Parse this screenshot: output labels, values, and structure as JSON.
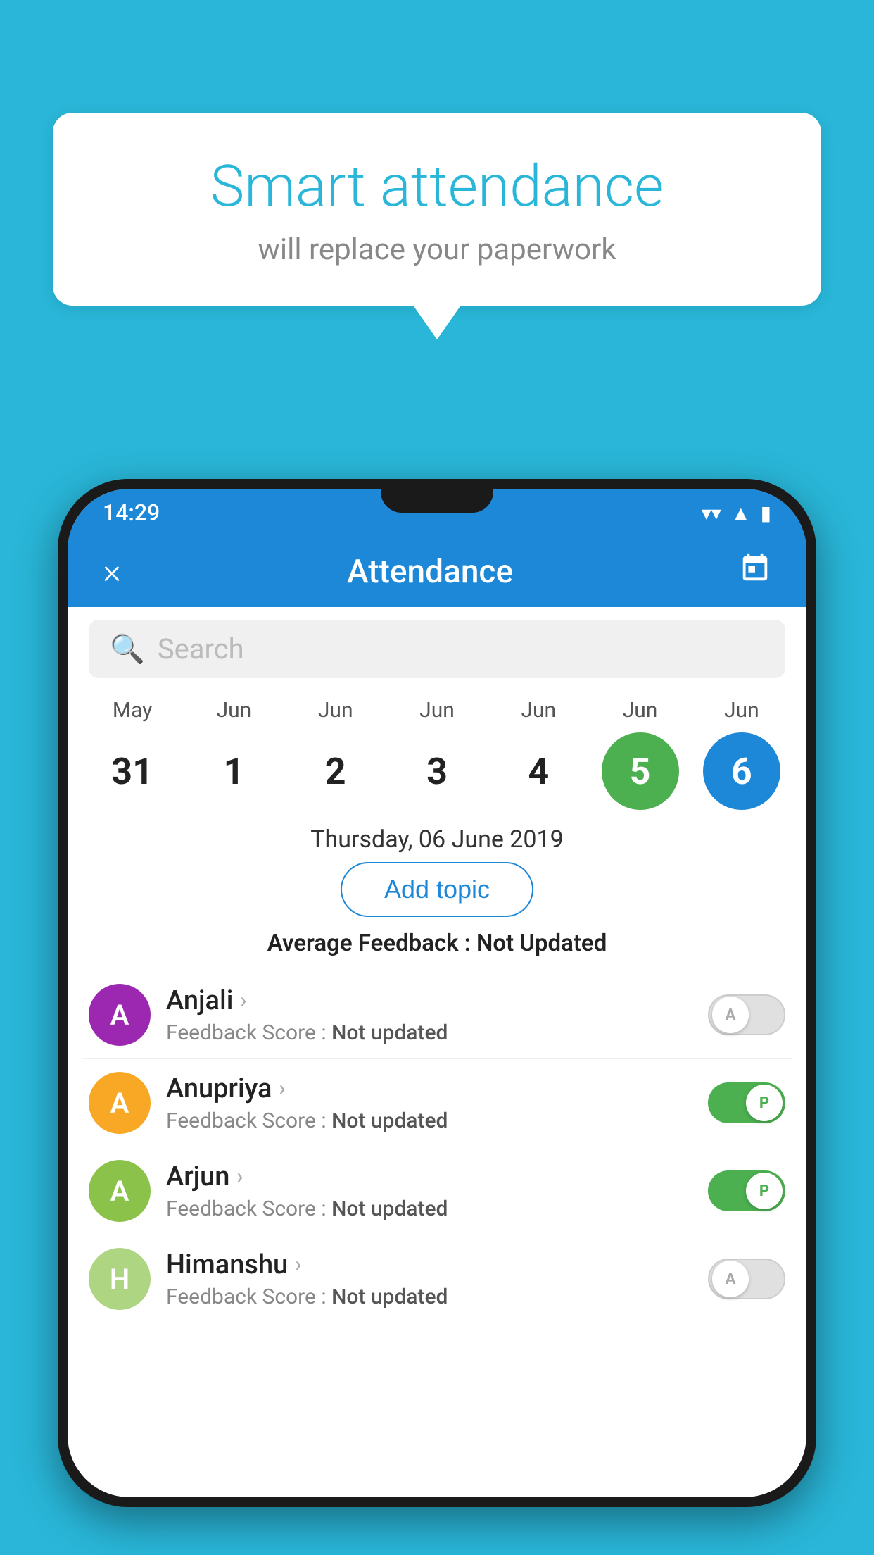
{
  "background_color": "#29b6d8",
  "speech_bubble": {
    "title": "Smart attendance",
    "subtitle": "will replace your paperwork"
  },
  "status_bar": {
    "time": "14:29",
    "icons": [
      "wifi",
      "signal",
      "battery"
    ]
  },
  "app_bar": {
    "title": "Attendance",
    "close_label": "×",
    "calendar_icon": "📅"
  },
  "search": {
    "placeholder": "Search"
  },
  "calendar": {
    "days": [
      {
        "month": "May",
        "date": "31",
        "selected": ""
      },
      {
        "month": "Jun",
        "date": "1",
        "selected": ""
      },
      {
        "month": "Jun",
        "date": "2",
        "selected": ""
      },
      {
        "month": "Jun",
        "date": "3",
        "selected": ""
      },
      {
        "month": "Jun",
        "date": "4",
        "selected": ""
      },
      {
        "month": "Jun",
        "date": "5",
        "selected": "green"
      },
      {
        "month": "Jun",
        "date": "6",
        "selected": "blue"
      }
    ]
  },
  "selected_date_label": "Thursday, 06 June 2019",
  "add_topic_label": "Add topic",
  "avg_feedback": {
    "label": "Average Feedback : ",
    "value": "Not Updated"
  },
  "students": [
    {
      "name": "Anjali",
      "avatar_letter": "A",
      "avatar_color": "#9c27b0",
      "score_label": "Feedback Score : ",
      "score_value": "Not updated",
      "toggle": "off",
      "toggle_letter": "A"
    },
    {
      "name": "Anupriya",
      "avatar_letter": "A",
      "avatar_color": "#f9a825",
      "score_label": "Feedback Score : ",
      "score_value": "Not updated",
      "toggle": "on",
      "toggle_letter": "P"
    },
    {
      "name": "Arjun",
      "avatar_letter": "A",
      "avatar_color": "#8bc34a",
      "score_label": "Feedback Score : ",
      "score_value": "Not updated",
      "toggle": "on",
      "toggle_letter": "P"
    },
    {
      "name": "Himanshu",
      "avatar_letter": "H",
      "avatar_color": "#aed581",
      "score_label": "Feedback Score : ",
      "score_value": "Not updated",
      "toggle": "off",
      "toggle_letter": "A"
    }
  ]
}
